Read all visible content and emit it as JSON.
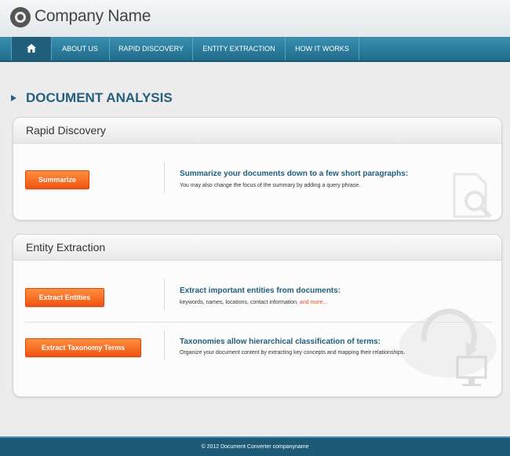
{
  "header": {
    "company_name": "Company Name"
  },
  "nav": {
    "home_icon": "home-icon",
    "items": [
      {
        "label": "ABOUT US"
      },
      {
        "label": "RAPID DISCOVERY"
      },
      {
        "label": "ENTITY EXTRACTION"
      },
      {
        "label": "HOW IT WORKS"
      }
    ]
  },
  "page": {
    "title": "DOCUMENT ANALYSIS"
  },
  "rapid_discovery": {
    "title": "Rapid Discovery",
    "summarize": {
      "button": "Summarize",
      "headline": "Summarize your documents down to a few short paragraphs:",
      "description": "You may also change the focus of the summary by adding a query phrase."
    }
  },
  "entity_extraction": {
    "title": "Entity Extraction",
    "extract_entities": {
      "button": "Extract Entities",
      "headline": "Extract important entities from documents:",
      "description": "keywords, names, locations, contact information,",
      "more_link": "and more..."
    },
    "taxonomy": {
      "button": "Extract Taxonomy Terms",
      "headline": "Taxonomies allow hierarchical classification of terms:",
      "description": "Organize your document content by extracting key concepts and mapping their relationships."
    }
  },
  "footer": {
    "text": "© 2012 Document Converter companyname"
  },
  "colors": {
    "nav": "#206c8c",
    "accent": "#f05312",
    "title": "#22607c",
    "footer": "#1d5a76"
  }
}
